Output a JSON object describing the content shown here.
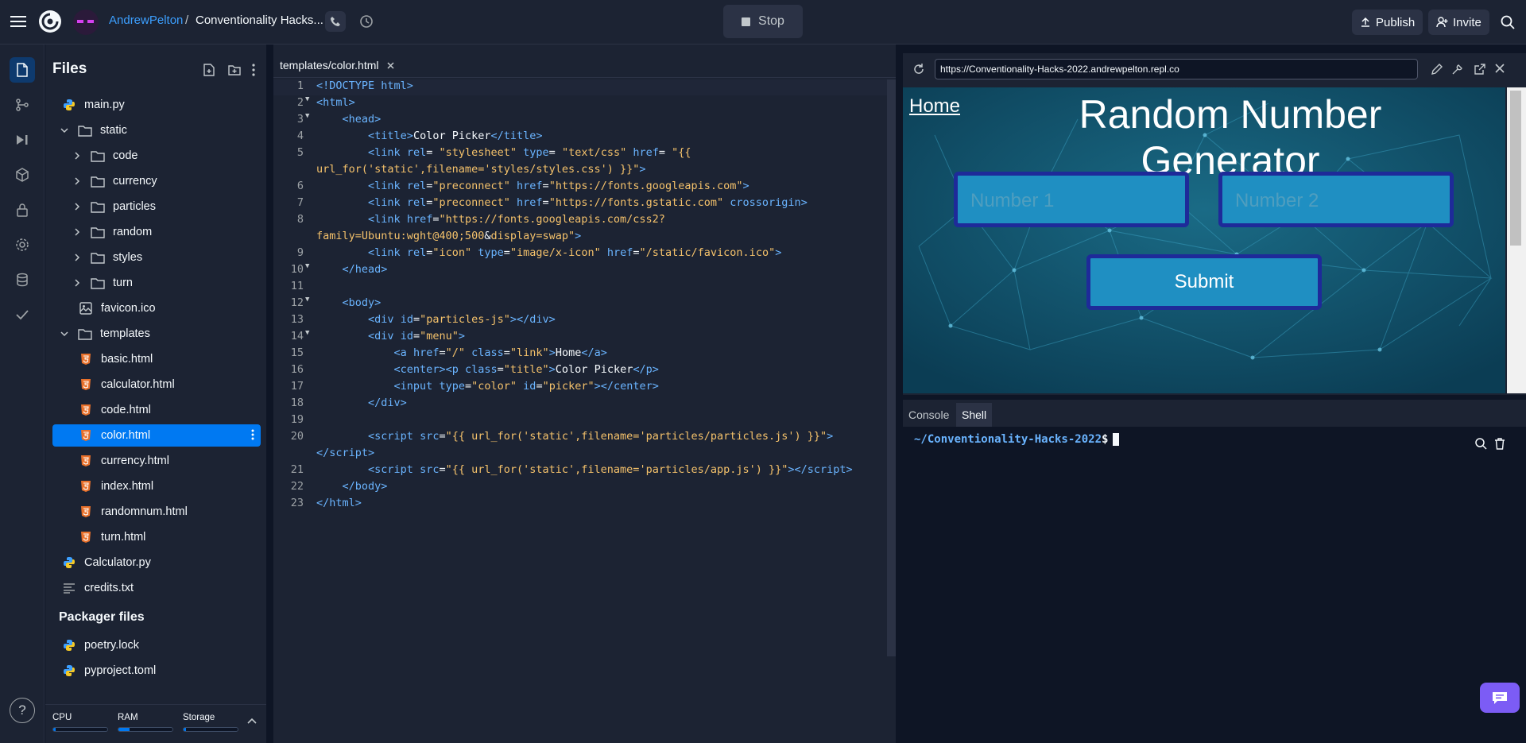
{
  "topbar": {
    "user": "AndrewPelton",
    "separator": "/",
    "repl_name": "Conventionality Hacks...",
    "stop_label": "Stop",
    "publish_label": "Publish",
    "invite_label": "Invite"
  },
  "files_panel": {
    "title": "Files",
    "tree": [
      {
        "name": "main.py",
        "icon": "python-icon",
        "depth": 1
      },
      {
        "name": "static",
        "icon": "folder-icon",
        "depth": 0,
        "expanded": true
      },
      {
        "name": "code",
        "icon": "folder-icon",
        "depth": 1
      },
      {
        "name": "currency",
        "icon": "folder-icon",
        "depth": 1
      },
      {
        "name": "particles",
        "icon": "folder-icon",
        "depth": 1
      },
      {
        "name": "random",
        "icon": "folder-icon",
        "depth": 1
      },
      {
        "name": "styles",
        "icon": "folder-icon",
        "depth": 1
      },
      {
        "name": "turn",
        "icon": "folder-icon",
        "depth": 1
      },
      {
        "name": "favicon.ico",
        "icon": "image-icon",
        "depth": 2
      },
      {
        "name": "templates",
        "icon": "folder-icon",
        "depth": 0,
        "expanded": true
      },
      {
        "name": "basic.html",
        "icon": "html5-icon",
        "depth": 2
      },
      {
        "name": "calculator.html",
        "icon": "html5-icon",
        "depth": 2
      },
      {
        "name": "code.html",
        "icon": "html5-icon",
        "depth": 2
      },
      {
        "name": "color.html",
        "icon": "html5-icon",
        "depth": 2,
        "selected": true
      },
      {
        "name": "currency.html",
        "icon": "html5-icon",
        "depth": 2
      },
      {
        "name": "index.html",
        "icon": "html5-icon",
        "depth": 2
      },
      {
        "name": "randomnum.html",
        "icon": "html5-icon",
        "depth": 2
      },
      {
        "name": "turn.html",
        "icon": "html5-icon",
        "depth": 2
      },
      {
        "name": "Calculator.py",
        "icon": "python-icon",
        "depth": 1
      },
      {
        "name": "credits.txt",
        "icon": "text-file-icon",
        "depth": 1
      }
    ],
    "packager_title": "Packager files",
    "packager": [
      {
        "name": "poetry.lock",
        "icon": "python-icon"
      },
      {
        "name": "pyproject.toml",
        "icon": "python-icon"
      }
    ],
    "resources": {
      "cpu": "CPU",
      "ram": "RAM",
      "storage": "Storage",
      "cpu_usage": 0.05,
      "ram_usage": 0.2,
      "storage_usage": 0.05
    }
  },
  "editor": {
    "tab_label": "templates/color.html",
    "line_numbers": [
      "1",
      "2",
      "3",
      "4",
      "5",
      "",
      "6",
      "7",
      "8",
      "",
      "9",
      "10",
      "11",
      "12",
      "13",
      "14",
      "15",
      "16",
      "17",
      "18",
      "19",
      "20",
      "",
      "21",
      "22",
      "23"
    ]
  },
  "webview": {
    "url": "https://Conventionality-Hacks-2022.andrewpelton.repl.co",
    "site": {
      "home_link": "Home",
      "title": "Random Number Generator",
      "number1_placeholder": "Number 1",
      "number2_placeholder": "Number 2",
      "submit_label": "Submit"
    }
  },
  "console": {
    "tabs": [
      "Console",
      "Shell"
    ],
    "active_tab": "Shell",
    "prompt_path": "~/Conventionality-Hacks-2022",
    "prompt_symbol": "$"
  },
  "colors": {
    "accent": "#0079f2",
    "background": "#0e1525",
    "panel": "#1c2333",
    "site_bg": "#0d4a63"
  }
}
